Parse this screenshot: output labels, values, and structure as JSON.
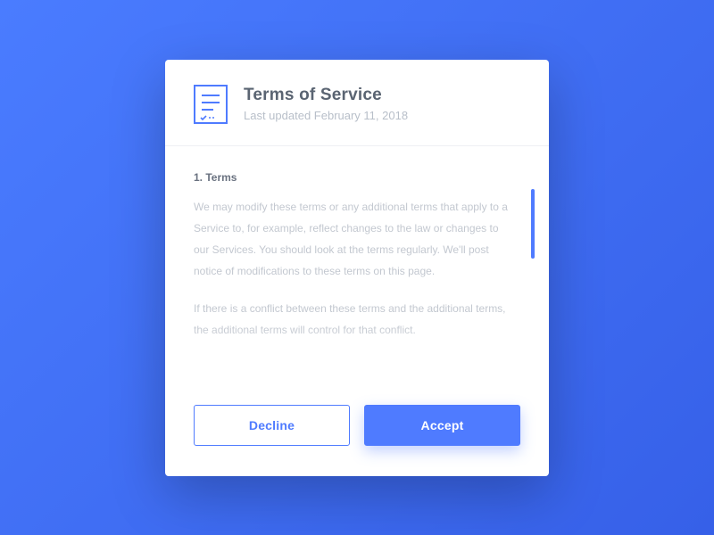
{
  "header": {
    "title": "Terms of Service",
    "subtitle": "Last updated February 11, 2018"
  },
  "content": {
    "section_heading": "1. Terms",
    "para1": "We may modify these terms or any additional terms that apply to a Service to, for example, reflect changes to the law or changes to our Services. You should look at the terms regularly. We'll post notice of modifications to these terms on this page.",
    "para2": "If there is a conflict between these terms and the additional terms, the additional terms will control for that conflict."
  },
  "buttons": {
    "decline": "Decline",
    "accept": "Accept"
  },
  "colors": {
    "accent": "#4f7bff"
  }
}
